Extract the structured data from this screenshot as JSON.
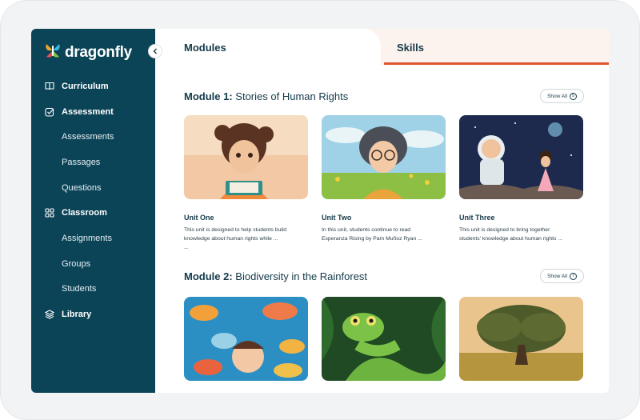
{
  "brand": {
    "name": "dragonfly",
    "colors": {
      "sidebar": "#0c4457",
      "accent": "#e0552f",
      "text": "#143a4a"
    }
  },
  "sidebar": {
    "items": [
      {
        "label": "Curriculum",
        "icon": "book-icon",
        "type": "section"
      },
      {
        "label": "Assessment",
        "icon": "checkbox-icon",
        "type": "section"
      },
      {
        "label": "Assessments",
        "type": "sub"
      },
      {
        "label": "Passages",
        "type": "sub"
      },
      {
        "label": "Questions",
        "type": "sub"
      },
      {
        "label": "Classroom",
        "icon": "grid-icon",
        "type": "section"
      },
      {
        "label": "Assignments",
        "type": "sub"
      },
      {
        "label": "Groups",
        "type": "sub"
      },
      {
        "label": "Students",
        "type": "sub"
      },
      {
        "label": "Library",
        "icon": "layers-icon",
        "type": "section"
      }
    ]
  },
  "tabs": {
    "modules": "Modules",
    "skills": "Skills",
    "active": "Modules"
  },
  "modules": [
    {
      "label": "Module 1:",
      "title": "Stories of Human Rights",
      "show_all": "Show All",
      "count": "5",
      "units": [
        {
          "title": "Unit One",
          "desc1": "This unit is designed to help students build",
          "desc2": "knowledge about human rights while ...",
          "desc3": "..."
        },
        {
          "title": "Unit Two",
          "desc1": "In this unit, students continue to read",
          "desc2": "Esperanza Rising by Pam Muñoz Ryan ...",
          "desc3": ""
        },
        {
          "title": "Unit Three",
          "desc1": "This unit is designed to bring together",
          "desc2": "students' knowledge about human rights ...",
          "desc3": ""
        }
      ]
    },
    {
      "label": "Module 2:",
      "title": "Biodiversity in the Rainforest",
      "show_all": "Show All",
      "count": "7"
    }
  ]
}
